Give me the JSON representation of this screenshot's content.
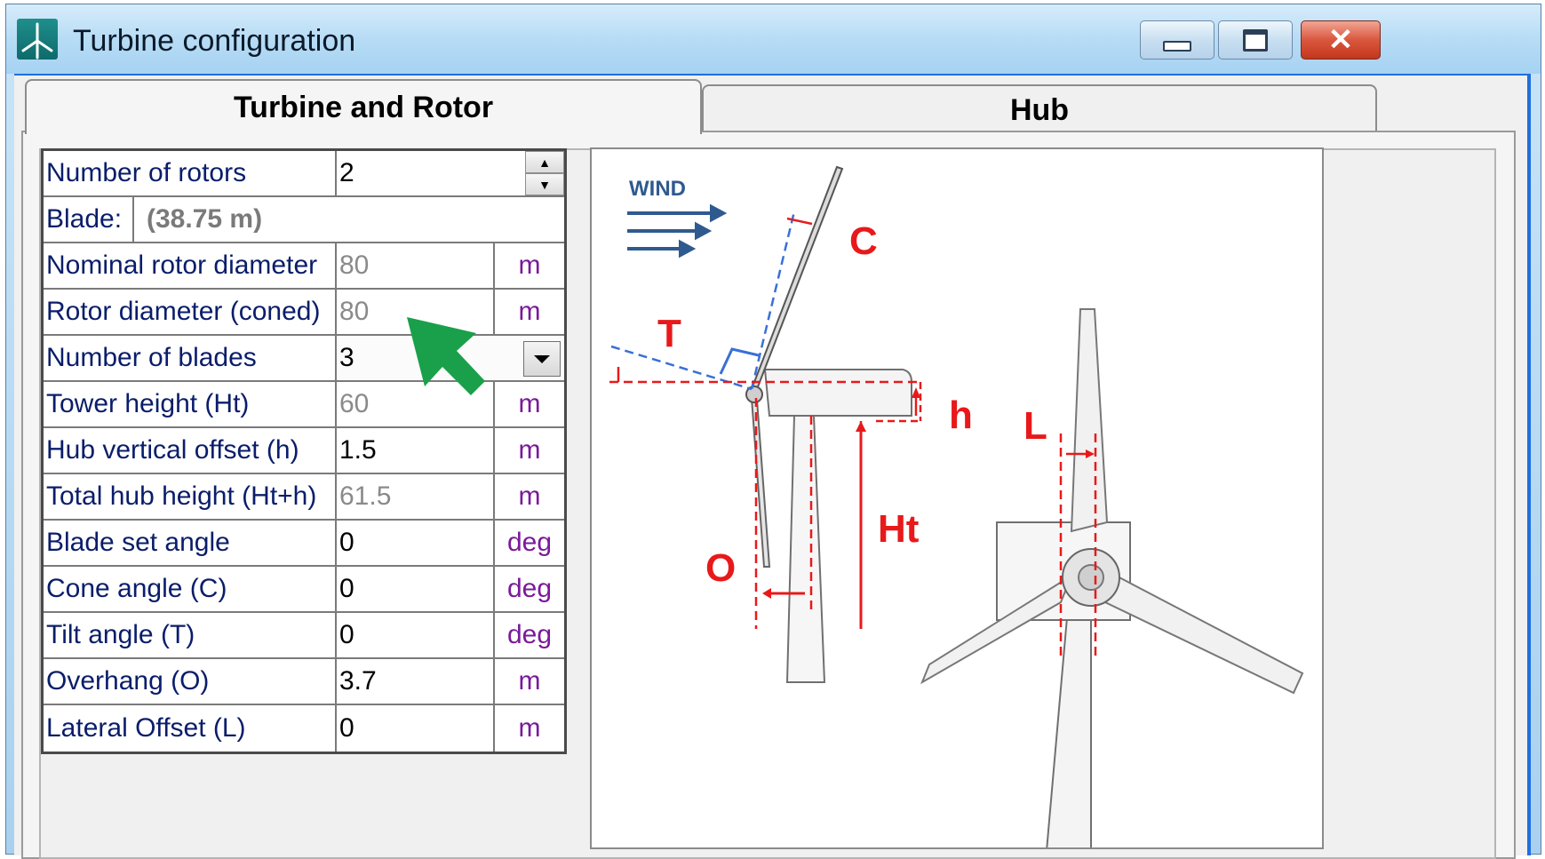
{
  "window": {
    "title": "Turbine configuration",
    "minimize_icon": "minimize-icon",
    "maximize_icon": "restore-icon",
    "close_icon": "close-icon"
  },
  "tabs": [
    {
      "label": "Turbine and Rotor",
      "active": true
    },
    {
      "label": "Hub",
      "active": false
    }
  ],
  "form": {
    "number_of_rotors": {
      "label": "Number of rotors",
      "value": "2"
    },
    "blade": {
      "label": "Blade:",
      "value": "(38.75 m)"
    },
    "rows": [
      {
        "label": "Nominal rotor diameter",
        "value": "80",
        "unit": "m",
        "readonly": true
      },
      {
        "label": "Rotor diameter (coned)",
        "value": "80",
        "unit": "m",
        "readonly": true
      }
    ],
    "number_of_blades": {
      "label": "Number of blades",
      "value": "3"
    },
    "rows2": [
      {
        "label": "Tower height (Ht)",
        "value": "60",
        "unit": "m",
        "readonly": true
      },
      {
        "label": "Hub vertical offset (h)",
        "value": "1.5",
        "unit": "m",
        "readonly": false
      },
      {
        "label": "Total hub height (Ht+h)",
        "value": "61.5",
        "unit": "m",
        "readonly": true
      },
      {
        "label": "Blade set angle",
        "value": "0",
        "unit": "deg",
        "readonly": false
      },
      {
        "label": "Cone angle (C)",
        "value": "0",
        "unit": "deg",
        "readonly": false
      },
      {
        "label": "Tilt angle (T)",
        "value": "0",
        "unit": "deg",
        "readonly": false
      },
      {
        "label": "Overhang (O)",
        "value": "3.7",
        "unit": "m",
        "readonly": false
      },
      {
        "label": "Lateral Offset (L)",
        "value": "0",
        "unit": "m",
        "readonly": false
      }
    ]
  },
  "diagram": {
    "wind_label": "WIND",
    "labels": {
      "C": "C",
      "T": "T",
      "h": "h",
      "L": "L",
      "Ht": "Ht",
      "O": "O"
    }
  },
  "colors": {
    "accent_red": "#e8191a",
    "wind_blue": "#2f5a8f",
    "pointer_green": "#1aa04a"
  }
}
